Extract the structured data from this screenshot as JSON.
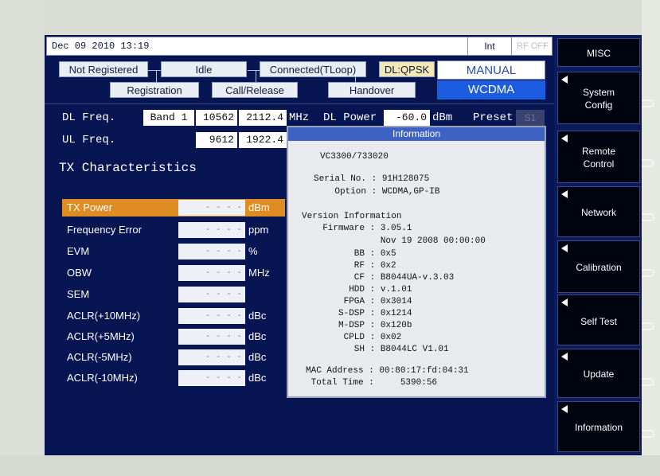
{
  "header": {
    "datetime": "Dec 09 2010   13:19",
    "int_label": "Int",
    "rf_label": "RF OFF"
  },
  "status": {
    "not_registered": "Not Registered",
    "idle": "Idle",
    "connected": "Connected(TLoop)",
    "dl_mod": "DL:QPSK",
    "registration": "Registration",
    "call_release": "Call/Release",
    "handover": "Handover",
    "mode_manual": "MANUAL",
    "mode_wcdma": "WCDMA"
  },
  "freq": {
    "dl_label": "DL Freq.",
    "ul_label": "UL Freq.",
    "band_label": "Band 1",
    "dl_channel": "10562",
    "dl_mhz": "2112.4",
    "ul_channel": "9612",
    "ul_mhz": "1922.4",
    "mhz_unit": "MHz",
    "dl_power_label": "DL Power",
    "dl_power_value": "-60.0",
    "dbm_unit": "dBm",
    "preset_label": "Preset",
    "preset_value": "S1"
  },
  "tx": {
    "title": "TX  Characteristics",
    "rows": [
      {
        "name": "TX Power",
        "value": "- - - -",
        "unit": "dBm"
      },
      {
        "name": "Frequency Error",
        "value": "- - - -",
        "unit": "ppm"
      },
      {
        "name": "EVM",
        "value": "- - - -",
        "unit": "%"
      },
      {
        "name": "OBW",
        "value": "- - - -",
        "unit": "MHz"
      },
      {
        "name": "SEM",
        "value": "- - - -",
        "unit": ""
      },
      {
        "name": "ACLR(+10MHz)",
        "value": "- - - -",
        "unit": "dBc"
      },
      {
        "name": "ACLR(+5MHz)",
        "value": "- - - -",
        "unit": "dBc"
      },
      {
        "name": "ACLR(-5MHz)",
        "value": "- - - -",
        "unit": "dBc"
      },
      {
        "name": "ACLR(-10MHz)",
        "value": "- - - -",
        "unit": "dBc"
      }
    ]
  },
  "dialog": {
    "title": "Information",
    "model": "VC3300/733020",
    "serial_line": "Serial No. : 91H128075",
    "option_line": "    Option : WCDMA,GP-IB",
    "version_heading": "Version Information",
    "firmware_line": "  Firmware : 3.05.1",
    "firmware_date": "             Nov 19 2008 00:00:00",
    "bb_line": "        BB : 0x5",
    "rf_line": "        RF : 0x2",
    "cf_line": "        CF : B8044UA-v.3.03",
    "hdd_line": "       HDD : v.1.01",
    "fpga_line": "      FPGA : 0x3014",
    "sdsp_line": "     S-DSP : 0x1214",
    "mdsp_line": "     M-DSP : 0x120b",
    "cpld_line": "      CPLD : 0x02",
    "sh_line": "        SH : B8044LC V1.01",
    "mac_line": "MAC Address : 00:80:17:fd:04:31",
    "time_line": " Total Time :     5390:56"
  },
  "softkeys": {
    "misc": "MISC",
    "system_config_1": "System",
    "system_config_2": "Config",
    "remote_control_1": "Remote",
    "remote_control_2": "Control",
    "network": "Network",
    "calibration": "Calibration",
    "self_test": "Self Test",
    "update": "Update",
    "information": "Information"
  }
}
